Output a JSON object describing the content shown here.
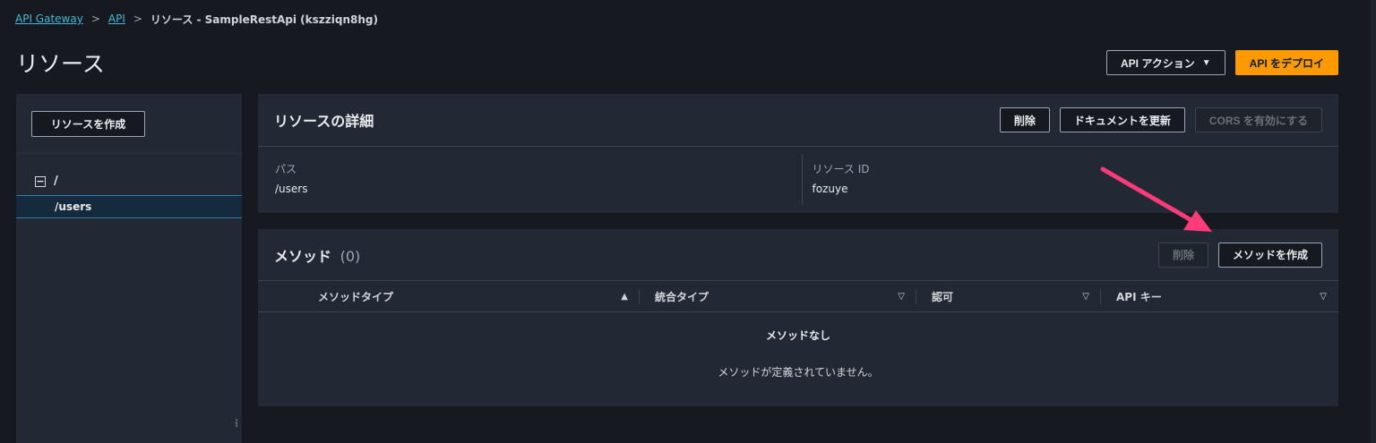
{
  "breadcrumb": {
    "items": [
      "API Gateway",
      "API"
    ],
    "current": "リソース - SampleRestApi (kszziqn8hg)"
  },
  "page": {
    "title": "リソース"
  },
  "top_actions": {
    "api_actions": "API アクション",
    "deploy": "API をデプロイ"
  },
  "sidebar": {
    "create_resource": "リソースを作成",
    "root": "/",
    "selected_item": "/users",
    "resize_glyph": "⁞"
  },
  "details": {
    "title": "リソースの詳細",
    "delete": "削除",
    "update_docs": "ドキュメントを更新",
    "enable_cors": "CORS を有効にする",
    "path_label": "パス",
    "path_value": "/users",
    "resource_id_label": "リソース ID",
    "resource_id_value": "fozuye"
  },
  "methods": {
    "title": "メソッド",
    "count": "(0)",
    "delete": "削除",
    "create": "メソッドを作成",
    "columns": [
      "メソッドタイプ",
      "統合タイプ",
      "認可",
      "API キー"
    ],
    "empty_title": "メソッドなし",
    "empty_desc": "メソッドが定義されていません。"
  },
  "colors": {
    "background": "#16191f",
    "panel": "#232934",
    "accent": "#ff9900",
    "link": "#44b9d6",
    "annotation_arrow": "#ff3b7a"
  }
}
